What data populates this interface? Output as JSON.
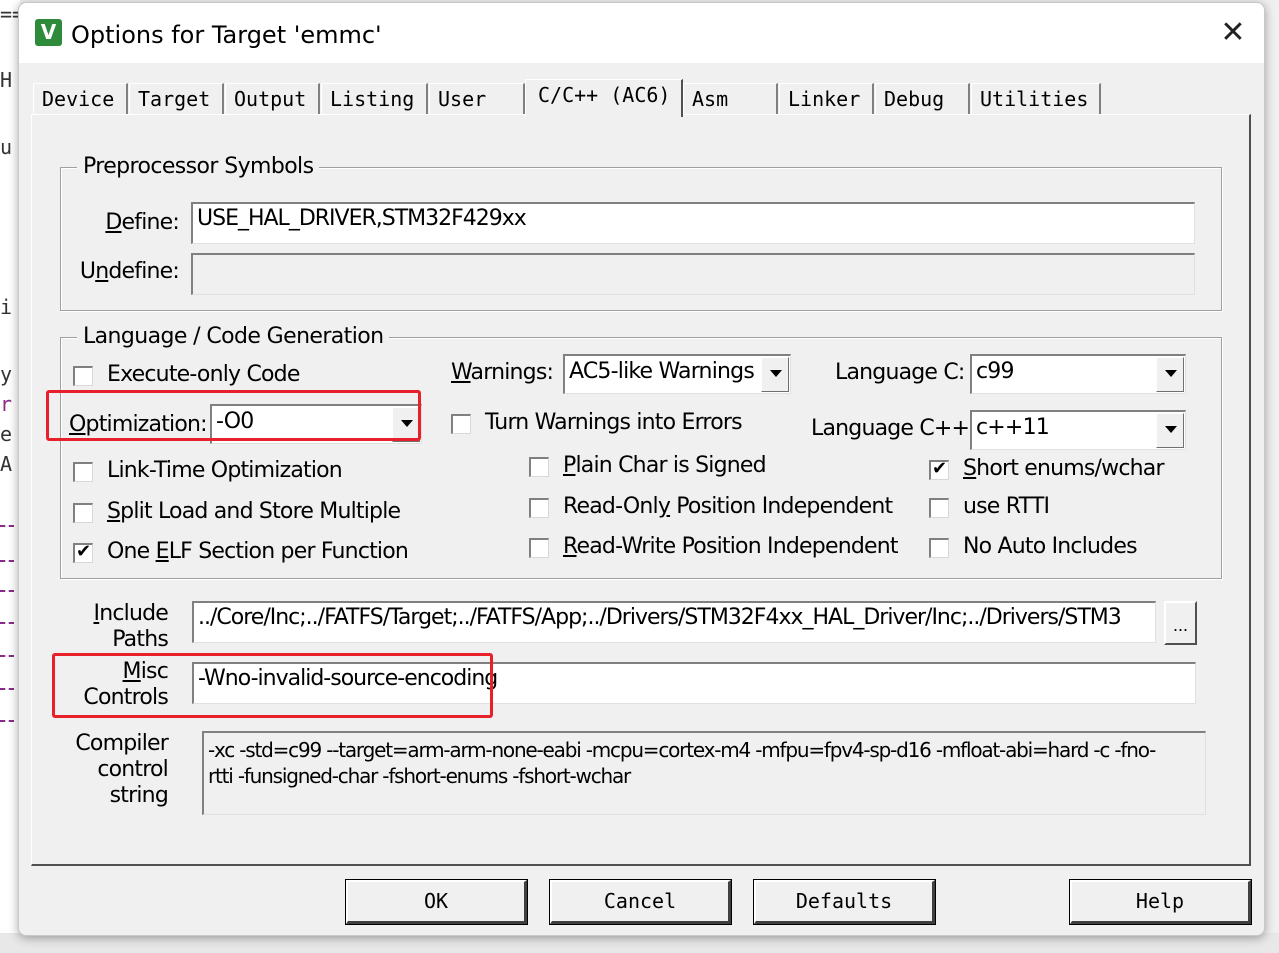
{
  "window": {
    "title": "Options for Target 'emmc'",
    "app_icon_text": "V",
    "close_glyph": "✕"
  },
  "tabs": [
    "Device",
    "Target",
    "Output",
    "Listing",
    "User",
    "C/C++ (AC6)",
    "Asm",
    "Linker",
    "Debug",
    "Utilities"
  ],
  "active_tab": "C/C++ (AC6)",
  "preprocessor": {
    "group_label": "Preprocessor Symbols",
    "define_label": "Define:",
    "define_value": "USE_HAL_DRIVER,STM32F429xx",
    "undefine_label": "Undefine:",
    "undefine_value": ""
  },
  "language": {
    "group_label": "Language / Code Generation",
    "execute_only": {
      "label": "Execute-only Code",
      "checked": false
    },
    "optimization_label": "Optimization:",
    "optimization_value": "-O0",
    "link_time": {
      "label": "Link-Time Optimization",
      "checked": false
    },
    "split_load": {
      "label": "Split Load and Store Multiple",
      "checked": false
    },
    "one_elf": {
      "label": "One ELF Section per Function",
      "checked": true
    },
    "warnings_label": "Warnings:",
    "warnings_value": "AC5-like Warnings",
    "turn_warnings": {
      "label": "Turn Warnings into Errors",
      "checked": false
    },
    "plain_char": {
      "label": "Plain Char is Signed",
      "checked": false
    },
    "ropi": {
      "label": "Read-Only Position Independent",
      "checked": false
    },
    "rwpi": {
      "label": "Read-Write Position Independent",
      "checked": false
    },
    "language_c_label": "Language C:",
    "language_c_value": "c99",
    "language_cpp_label": "Language C++:",
    "language_cpp_value": "c++11",
    "short_enums": {
      "label": "Short enums/wchar",
      "checked": true
    },
    "use_rtti": {
      "label": "use RTTI",
      "checked": false
    },
    "no_auto_includes": {
      "label": "No Auto Includes",
      "checked": false
    }
  },
  "include": {
    "label_line1": "Include",
    "label_line2": "Paths",
    "value": "../Core/Inc;../FATFS/Target;../FATFS/App;../Drivers/STM32F4xx_HAL_Driver/Inc;../Drivers/STM3",
    "browse_label": "..."
  },
  "misc": {
    "label_line1": "Misc",
    "label_line2": "Controls",
    "value": "-Wno-invalid-source-encoding"
  },
  "compiler": {
    "label_line1": "Compiler",
    "label_line2": "control",
    "label_line3": "string",
    "value": "-xc -std=c99 --target=arm-arm-none-eabi -mcpu=cortex-m4 -mfpu=fpv4-sp-d16 -mfloat-abi=hard -c -fno-rtti -funsigned-char -fshort-enums -fshort-wchar"
  },
  "buttons": {
    "ok": "OK",
    "cancel": "Cancel",
    "defaults": "Defaults",
    "help": "Help"
  },
  "colors": {
    "highlight": "#e8202a",
    "icon_green": "#2e8b3a"
  }
}
